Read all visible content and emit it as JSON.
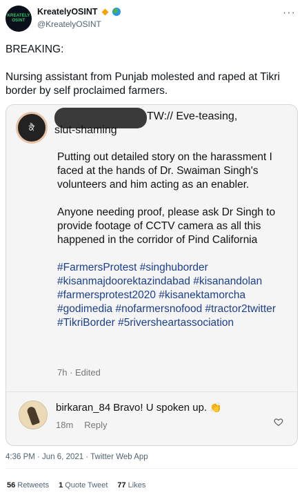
{
  "author": {
    "display_name": "KreatelyOSINT",
    "handle": "@KreatelyOSINT",
    "avatar_text": "KREATELY\nOSINT",
    "badge_color": "#f4a300"
  },
  "tweet": {
    "line1": "BREAKING:",
    "line2": "Nursing assistant from Punjab molested and raped at Tikri border by self proclaimed farmers."
  },
  "story": {
    "avatar_text": "ਕੈ",
    "header_part1": "TW:// Eve-teasing,",
    "header_part2": "slut-shaming",
    "para1": "Putting out detailed story on the harassment I faced at the hands of Dr. Swaiman Singh's volunteers and him acting as an enabler.",
    "para2": "Anyone needing proof, please ask Dr Singh to provide footage of CCTV camera as all this happened in the corridor of Pind California",
    "hashtags": "#FarmersProtest #singhuborder #kisanmajdoorektazindabad #kisanandolan #farmersprotest2020 #kisanektamorcha #godimedia #nofarmersnofood #tractor2twitter #TikriBorder #5riversheartassociation",
    "time": "7h · Edited"
  },
  "comment": {
    "username": "birkaran_84",
    "text": "Bravo! U spoken up.",
    "age": "18m",
    "reply_label": "Reply"
  },
  "meta": {
    "timestamp": "4:36 PM · Jun 6, 2021 · Twitter Web App"
  },
  "stats": {
    "retweets_count": "56",
    "retweets_label": "Retweets",
    "quotes_count": "1",
    "quotes_label": "Quote Tweet",
    "likes_count": "77",
    "likes_label": "Likes"
  }
}
